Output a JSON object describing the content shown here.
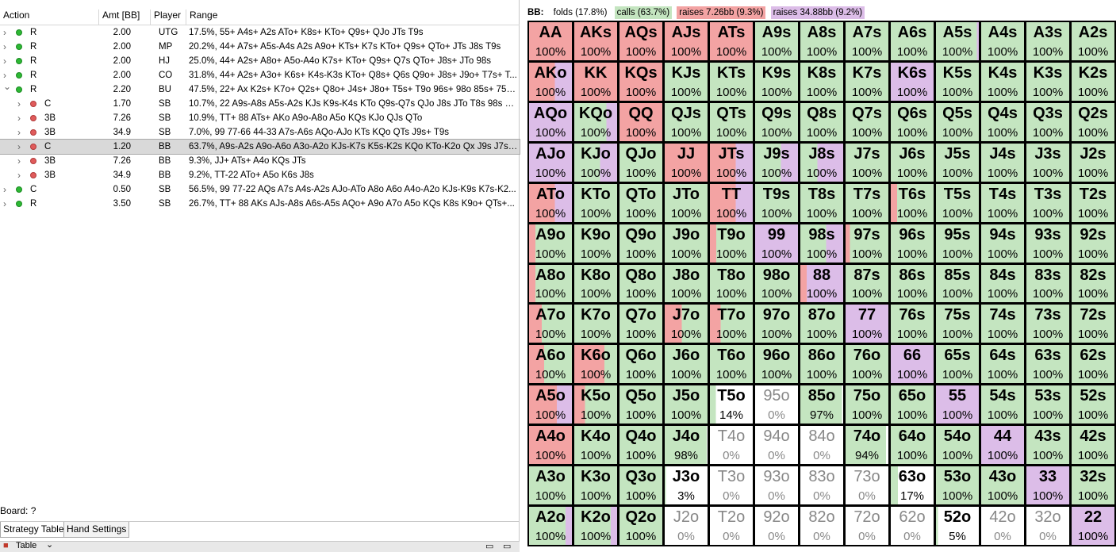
{
  "table_headers": {
    "action": "Action",
    "amt": "Amt [BB]",
    "player": "Player",
    "range": "Range"
  },
  "actions": [
    {
      "action": "R",
      "amt": "2.00",
      "player": "UTG",
      "range": "17.5%, 55+ A4s+ A2s ATo+ K8s+ KTo+ Q9s+ QJo JTs T9s",
      "indent": 0,
      "expander": ">",
      "dot": "green",
      "selected": false
    },
    {
      "action": "R",
      "amt": "2.00",
      "player": "MP",
      "range": "20.2%, 44+ A7s+ A5s-A4s A2s A9o+ KTs+ K7s KTo+ Q9s+ QTo+ JTs J8s T9s",
      "indent": 0,
      "expander": ">",
      "dot": "green",
      "selected": false
    },
    {
      "action": "R",
      "amt": "2.00",
      "player": "HJ",
      "range": "25.0%, 44+ A2s+ A8o+ A5o-A4o K7s+ KTo+ Q9s+ Q7s QTo+ J8s+ JTo 98s",
      "indent": 0,
      "expander": ">",
      "dot": "green",
      "selected": false
    },
    {
      "action": "R",
      "amt": "2.00",
      "player": "CO",
      "range": "31.8%, 44+ A2s+ A3o+ K6s+ K4s-K3s KTo+ Q8s+ Q6s Q9o+ J8s+ J9o+ T7s+ T...",
      "indent": 0,
      "expander": ">",
      "dot": "green",
      "selected": false
    },
    {
      "action": "R",
      "amt": "2.20",
      "player": "BU",
      "range": "47.5%, 22+ Ax K2s+ K7o+ Q2s+ Q8o+ J4s+ J8o+ T5s+ T9o 96s+ 98o 85s+ 75s...",
      "indent": 0,
      "expander": "v",
      "dot": "green",
      "selected": false
    },
    {
      "action": "C",
      "amt": "1.70",
      "player": "SB",
      "range": "10.7%, 22 A9s-A8s A5s-A2s KJs K9s-K4s KTo Q9s-Q7s QJo J8s JTo T8s 98s 87s ...",
      "indent": 1,
      "expander": ">",
      "dot": "red",
      "selected": false
    },
    {
      "action": "3B",
      "amt": "7.26",
      "player": "SB",
      "range": "10.9%, TT+ 88 ATs+ AKo A9o-A8o A5o KQs KJo QJs QTo",
      "indent": 1,
      "expander": ">",
      "dot": "red",
      "selected": false
    },
    {
      "action": "3B",
      "amt": "34.9",
      "player": "SB",
      "range": "7.0%, 99 77-66 44-33 A7s-A6s AQo-AJo KTs KQo QTs J9s+ T9s",
      "indent": 1,
      "expander": ">",
      "dot": "red",
      "selected": false
    },
    {
      "action": "C",
      "amt": "1.20",
      "player": "BB",
      "range": "63.7%, A9s-A2s A9o-A6o A3o-A2o KJs-K7s K5s-K2s KQo KTo-K2o Qx J9s J7s-J...",
      "indent": 1,
      "expander": ">",
      "dot": "red",
      "selected": true
    },
    {
      "action": "3B",
      "amt": "7.26",
      "player": "BB",
      "range": "9.3%, JJ+ ATs+ A4o KQs JTs",
      "indent": 1,
      "expander": ">",
      "dot": "red",
      "selected": false
    },
    {
      "action": "3B",
      "amt": "34.9",
      "player": "BB",
      "range": "9.2%, TT-22 ATo+ A5o K6s J8s",
      "indent": 1,
      "expander": ">",
      "dot": "red",
      "selected": false
    },
    {
      "action": "C",
      "amt": "0.50",
      "player": "SB",
      "range": "56.5%, 99 77-22 AQs A7s A4s-A2s AJo-ATo A8o A6o A4o-A2o KJs-K9s K7s-K2...",
      "indent": 0,
      "expander": ">",
      "dot": "green",
      "selected": false
    },
    {
      "action": "R",
      "amt": "3.50",
      "player": "SB",
      "range": "26.7%, TT+ 88 AKs AJs-A8s A6s-A5s AQo+ A9o A7o A5o KQs K8s K9o+ QTs+...",
      "indent": 0,
      "expander": ">",
      "dot": "green",
      "selected": false
    }
  ],
  "board": "Board: ?",
  "tabs": [
    {
      "label": "Strategy Table",
      "active": true
    },
    {
      "label": "Hand Settings",
      "active": false
    }
  ],
  "bottom_label": "Table",
  "legend": {
    "player": "BB:",
    "folds": "folds (17.8%)",
    "calls": "calls (63.7%)",
    "raise1": "raises 7.26bb (9.3%)",
    "raise2": "raises 34.88bb (9.2%)"
  },
  "colors": {
    "fold": "#ffffff",
    "call": "#c4e5c0",
    "raise_small": "#f3a3a3",
    "raise_big": "#dcbde8",
    "selected_row": "#d9d9d9"
  },
  "grid": [
    [
      [
        "AA",
        "100%",
        0,
        100,
        0
      ],
      [
        "AKs",
        "100%",
        0,
        100,
        0
      ],
      [
        "AQs",
        "100%",
        0,
        100,
        0
      ],
      [
        "AJs",
        "100%",
        0,
        100,
        0
      ],
      [
        "ATs",
        "100%",
        0,
        100,
        0
      ],
      [
        "A9s",
        "100%",
        100,
        0,
        0
      ],
      [
        "A8s",
        "100%",
        100,
        0,
        0
      ],
      [
        "A7s",
        "100%",
        100,
        0,
        0
      ],
      [
        "A6s",
        "100%",
        100,
        0,
        0
      ],
      [
        "A5s",
        "100%",
        95,
        0,
        5
      ],
      [
        "A4s",
        "100%",
        100,
        0,
        0
      ],
      [
        "A3s",
        "100%",
        100,
        0,
        0
      ],
      [
        "A2s",
        "100%",
        100,
        0,
        0
      ]
    ],
    [
      [
        "AKo",
        "100%",
        0,
        60,
        40
      ],
      [
        "KK",
        "100%",
        0,
        100,
        0
      ],
      [
        "KQs",
        "100%",
        0,
        100,
        0
      ],
      [
        "KJs",
        "100%",
        100,
        0,
        0
      ],
      [
        "KTs",
        "100%",
        100,
        0,
        0
      ],
      [
        "K9s",
        "100%",
        100,
        0,
        0
      ],
      [
        "K8s",
        "100%",
        100,
        0,
        0
      ],
      [
        "K7s",
        "100%",
        100,
        0,
        0
      ],
      [
        "K6s",
        "100%",
        0,
        0,
        100
      ],
      [
        "K5s",
        "100%",
        100,
        0,
        0
      ],
      [
        "K4s",
        "100%",
        100,
        0,
        0
      ],
      [
        "K3s",
        "100%",
        100,
        0,
        0
      ],
      [
        "K2s",
        "100%",
        100,
        0,
        0
      ]
    ],
    [
      [
        "AQo",
        "100%",
        0,
        0,
        100
      ],
      [
        "KQo",
        "100%",
        75,
        0,
        25
      ],
      [
        "QQ",
        "100%",
        0,
        100,
        0
      ],
      [
        "QJs",
        "100%",
        100,
        0,
        0
      ],
      [
        "QTs",
        "100%",
        100,
        0,
        0
      ],
      [
        "Q9s",
        "100%",
        100,
        0,
        0
      ],
      [
        "Q8s",
        "100%",
        100,
        0,
        0
      ],
      [
        "Q7s",
        "100%",
        100,
        0,
        0
      ],
      [
        "Q6s",
        "100%",
        100,
        0,
        0
      ],
      [
        "Q5s",
        "100%",
        100,
        0,
        0
      ],
      [
        "Q4s",
        "100%",
        100,
        0,
        0
      ],
      [
        "Q3s",
        "100%",
        100,
        0,
        0
      ],
      [
        "Q2s",
        "100%",
        100,
        0,
        0
      ]
    ],
    [
      [
        "AJo",
        "100%",
        0,
        0,
        100
      ],
      [
        "KJo",
        "100%",
        60,
        0,
        40
      ],
      [
        "QJo",
        "100%",
        100,
        0,
        0
      ],
      [
        "JJ",
        "100%",
        0,
        100,
        0
      ],
      [
        "JTs",
        "100%",
        0,
        60,
        40
      ],
      [
        "J9s",
        "100%",
        60,
        0,
        40
      ],
      [
        "J8s",
        "100%",
        40,
        0,
        60
      ],
      [
        "J7s",
        "100%",
        100,
        0,
        0
      ],
      [
        "J6s",
        "100%",
        100,
        0,
        0
      ],
      [
        "J5s",
        "100%",
        100,
        0,
        0
      ],
      [
        "J4s",
        "100%",
        100,
        0,
        0
      ],
      [
        "J3s",
        "100%",
        100,
        0,
        0
      ],
      [
        "J2s",
        "100%",
        100,
        0,
        0
      ]
    ],
    [
      [
        "ATo",
        "100%",
        0,
        60,
        40
      ],
      [
        "KTo",
        "100%",
        100,
        0,
        0
      ],
      [
        "QTo",
        "100%",
        100,
        0,
        0
      ],
      [
        "JTo",
        "100%",
        100,
        0,
        0
      ],
      [
        "TT",
        "100%",
        0,
        60,
        40
      ],
      [
        "T9s",
        "100%",
        100,
        0,
        0
      ],
      [
        "T8s",
        "100%",
        100,
        0,
        0
      ],
      [
        "T7s",
        "100%",
        100,
        0,
        0
      ],
      [
        "T6s",
        "100%",
        85,
        15,
        0
      ],
      [
        "T5s",
        "100%",
        100,
        0,
        0
      ],
      [
        "T4s",
        "100%",
        100,
        0,
        0
      ],
      [
        "T3s",
        "100%",
        100,
        0,
        0
      ],
      [
        "T2s",
        "100%",
        100,
        0,
        0
      ]
    ],
    [
      [
        "A9o",
        "100%",
        85,
        15,
        0
      ],
      [
        "K9o",
        "100%",
        100,
        0,
        0
      ],
      [
        "Q9o",
        "100%",
        100,
        0,
        0
      ],
      [
        "J9o",
        "100%",
        100,
        0,
        0
      ],
      [
        "T9o",
        "100%",
        85,
        15,
        0
      ],
      [
        "99",
        "100%",
        0,
        0,
        100
      ],
      [
        "98s",
        "100%",
        60,
        0,
        40
      ],
      [
        "97s",
        "100%",
        90,
        10,
        0
      ],
      [
        "96s",
        "100%",
        100,
        0,
        0
      ],
      [
        "95s",
        "100%",
        100,
        0,
        0
      ],
      [
        "94s",
        "100%",
        100,
        0,
        0
      ],
      [
        "93s",
        "100%",
        100,
        0,
        0
      ],
      [
        "92s",
        "100%",
        100,
        0,
        0
      ]
    ],
    [
      [
        "A8o",
        "100%",
        85,
        15,
        0
      ],
      [
        "K8o",
        "100%",
        100,
        0,
        0
      ],
      [
        "Q8o",
        "100%",
        100,
        0,
        0
      ],
      [
        "J8o",
        "100%",
        100,
        0,
        0
      ],
      [
        "T8o",
        "100%",
        100,
        0,
        0
      ],
      [
        "98o",
        "100%",
        100,
        0,
        0
      ],
      [
        "88",
        "100%",
        0,
        15,
        85
      ],
      [
        "87s",
        "100%",
        100,
        0,
        0
      ],
      [
        "86s",
        "100%",
        100,
        0,
        0
      ],
      [
        "85s",
        "100%",
        100,
        0,
        0
      ],
      [
        "84s",
        "100%",
        100,
        0,
        0
      ],
      [
        "83s",
        "100%",
        100,
        0,
        0
      ],
      [
        "82s",
        "100%",
        100,
        0,
        0
      ]
    ],
    [
      [
        "A7o",
        "100%",
        70,
        30,
        0
      ],
      [
        "K7o",
        "100%",
        100,
        0,
        0
      ],
      [
        "Q7o",
        "100%",
        100,
        0,
        0
      ],
      [
        "J7o",
        "100%",
        60,
        40,
        0
      ],
      [
        "T7o",
        "100%",
        75,
        25,
        0
      ],
      [
        "97o",
        "100%",
        100,
        0,
        0
      ],
      [
        "87o",
        "100%",
        100,
        0,
        0
      ],
      [
        "77",
        "100%",
        0,
        0,
        100
      ],
      [
        "76s",
        "100%",
        100,
        0,
        0
      ],
      [
        "75s",
        "100%",
        100,
        0,
        0
      ],
      [
        "74s",
        "100%",
        100,
        0,
        0
      ],
      [
        "73s",
        "100%",
        100,
        0,
        0
      ],
      [
        "72s",
        "100%",
        100,
        0,
        0
      ]
    ],
    [
      [
        "A6o",
        "100%",
        65,
        35,
        0
      ],
      [
        "K6o",
        "100%",
        30,
        70,
        0
      ],
      [
        "Q6o",
        "100%",
        100,
        0,
        0
      ],
      [
        "J6o",
        "100%",
        100,
        0,
        0
      ],
      [
        "T6o",
        "100%",
        100,
        0,
        0
      ],
      [
        "96o",
        "100%",
        100,
        0,
        0
      ],
      [
        "86o",
        "100%",
        100,
        0,
        0
      ],
      [
        "76o",
        "100%",
        100,
        0,
        0
      ],
      [
        "66",
        "100%",
        0,
        0,
        100
      ],
      [
        "65s",
        "100%",
        100,
        0,
        0
      ],
      [
        "64s",
        "100%",
        100,
        0,
        0
      ],
      [
        "63s",
        "100%",
        100,
        0,
        0
      ],
      [
        "62s",
        "100%",
        100,
        0,
        0
      ]
    ],
    [
      [
        "A5o",
        "100%",
        0,
        65,
        35
      ],
      [
        "K5o",
        "100%",
        75,
        25,
        0
      ],
      [
        "Q5o",
        "100%",
        100,
        0,
        0
      ],
      [
        "J5o",
        "100%",
        100,
        0,
        0
      ],
      [
        "T5o",
        "14%",
        14,
        0,
        0
      ],
      [
        "95o",
        "0%",
        0,
        0,
        0
      ],
      [
        "85o",
        "97%",
        97,
        0,
        0
      ],
      [
        "75o",
        "100%",
        100,
        0,
        0
      ],
      [
        "65o",
        "100%",
        100,
        0,
        0
      ],
      [
        "55",
        "100%",
        0,
        0,
        100
      ],
      [
        "54s",
        "100%",
        100,
        0,
        0
      ],
      [
        "53s",
        "100%",
        100,
        0,
        0
      ],
      [
        "52s",
        "100%",
        100,
        0,
        0
      ]
    ],
    [
      [
        "A4o",
        "100%",
        0,
        100,
        0
      ],
      [
        "K4o",
        "100%",
        100,
        0,
        0
      ],
      [
        "Q4o",
        "100%",
        100,
        0,
        0
      ],
      [
        "J4o",
        "98%",
        98,
        0,
        0
      ],
      [
        "T4o",
        "0%",
        0,
        0,
        0
      ],
      [
        "94o",
        "0%",
        0,
        0,
        0
      ],
      [
        "84o",
        "0%",
        0,
        0,
        0
      ],
      [
        "74o",
        "94%",
        94,
        0,
        0
      ],
      [
        "64o",
        "100%",
        100,
        0,
        0
      ],
      [
        "54o",
        "100%",
        100,
        0,
        0
      ],
      [
        "44",
        "100%",
        0,
        0,
        100
      ],
      [
        "43s",
        "100%",
        100,
        0,
        0
      ],
      [
        "42s",
        "100%",
        100,
        0,
        0
      ]
    ],
    [
      [
        "A3o",
        "100%",
        100,
        0,
        0
      ],
      [
        "K3o",
        "100%",
        100,
        0,
        0
      ],
      [
        "Q3o",
        "100%",
        100,
        0,
        0
      ],
      [
        "J3o",
        "3%",
        3,
        0,
        0
      ],
      [
        "T3o",
        "0%",
        0,
        0,
        0
      ],
      [
        "93o",
        "0%",
        0,
        0,
        0
      ],
      [
        "83o",
        "0%",
        0,
        0,
        0
      ],
      [
        "73o",
        "0%",
        0,
        0,
        0
      ],
      [
        "63o",
        "17%",
        17,
        0,
        0
      ],
      [
        "53o",
        "100%",
        100,
        0,
        0
      ],
      [
        "43o",
        "100%",
        100,
        0,
        0
      ],
      [
        "33",
        "100%",
        0,
        0,
        100
      ],
      [
        "32s",
        "100%",
        100,
        0,
        0
      ]
    ],
    [
      [
        "A2o",
        "100%",
        85,
        0,
        15
      ],
      [
        "K2o",
        "100%",
        85,
        0,
        15
      ],
      [
        "Q2o",
        "100%",
        100,
        0,
        0
      ],
      [
        "J2o",
        "0%",
        0,
        0,
        0
      ],
      [
        "T2o",
        "0%",
        0,
        0,
        0
      ],
      [
        "92o",
        "0%",
        0,
        0,
        0
      ],
      [
        "82o",
        "0%",
        0,
        0,
        0
      ],
      [
        "72o",
        "0%",
        0,
        0,
        0
      ],
      [
        "62o",
        "0%",
        0,
        0,
        0
      ],
      [
        "52o",
        "5%",
        5,
        0,
        0
      ],
      [
        "42o",
        "0%",
        0,
        0,
        0
      ],
      [
        "32o",
        "0%",
        0,
        0,
        0
      ],
      [
        "22",
        "100%",
        0,
        0,
        100
      ]
    ]
  ]
}
